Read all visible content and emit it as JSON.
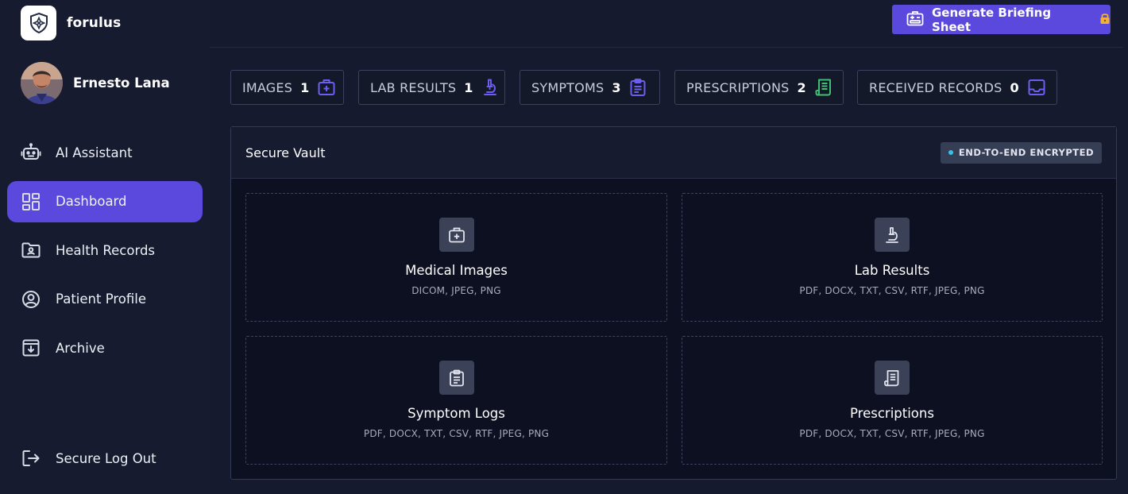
{
  "brand": {
    "name": "forulus",
    "logo_icon": "shield-logo-icon"
  },
  "user": {
    "name": "Ernesto Lana",
    "avatar_icon": "user-avatar"
  },
  "sidebar": {
    "items": [
      {
        "label": "AI Assistant",
        "icon": "robot-icon",
        "active": false
      },
      {
        "label": "Dashboard",
        "icon": "grid-dashboard-icon",
        "active": true
      },
      {
        "label": "Health Records",
        "icon": "folder-user-icon",
        "active": false
      },
      {
        "label": "Patient Profile",
        "icon": "user-circle-icon",
        "active": false
      },
      {
        "label": "Archive",
        "icon": "archive-download-icon",
        "active": false
      }
    ],
    "logout_label": "Secure Log Out"
  },
  "header": {
    "briefing_button_label": "Generate Briefing Sheet",
    "briefing_icon": "briefing-sheet-icon",
    "lock_icon": "lock-icon"
  },
  "stats": [
    {
      "label": "IMAGES",
      "count": "1",
      "icon": "medical-case-icon",
      "color": "#6f5cf0"
    },
    {
      "label": "LAB RESULTS",
      "count": "1",
      "icon": "microscope-icon",
      "color": "#6f5cf0"
    },
    {
      "label": "SYMPTOMS",
      "count": "3",
      "icon": "clipboard-icon",
      "color": "#6f5cf0"
    },
    {
      "label": "PRESCRIPTIONS",
      "count": "2",
      "icon": "prescription-receipt-icon",
      "color": "#3fbf72"
    },
    {
      "label": "RECEIVED RECORDS",
      "count": "0",
      "icon": "inbox-icon",
      "color": "#6f5cf0"
    }
  ],
  "vault": {
    "title": "Secure Vault",
    "badge": "END-TO-END ENCRYPTED",
    "cards": [
      {
        "title": "Medical Images",
        "formats": "DICOM, JPEG, PNG",
        "icon": "medical-case-icon"
      },
      {
        "title": "Lab Results",
        "formats": "PDF, DOCX, TXT, CSV, RTF, JPEG, PNG",
        "icon": "microscope-icon"
      },
      {
        "title": "Symptom Logs",
        "formats": "PDF, DOCX, TXT, CSV, RTF, JPEG, PNG",
        "icon": "clipboard-icon"
      },
      {
        "title": "Prescriptions",
        "formats": "PDF, DOCX, TXT, CSV, RTF, JPEG, PNG",
        "icon": "prescription-receipt-icon"
      }
    ]
  },
  "colors": {
    "accent": "#5b49dd",
    "background": "#151a2e",
    "vault_background": "#0d1020",
    "encryption_dot": "#38c2e8"
  }
}
